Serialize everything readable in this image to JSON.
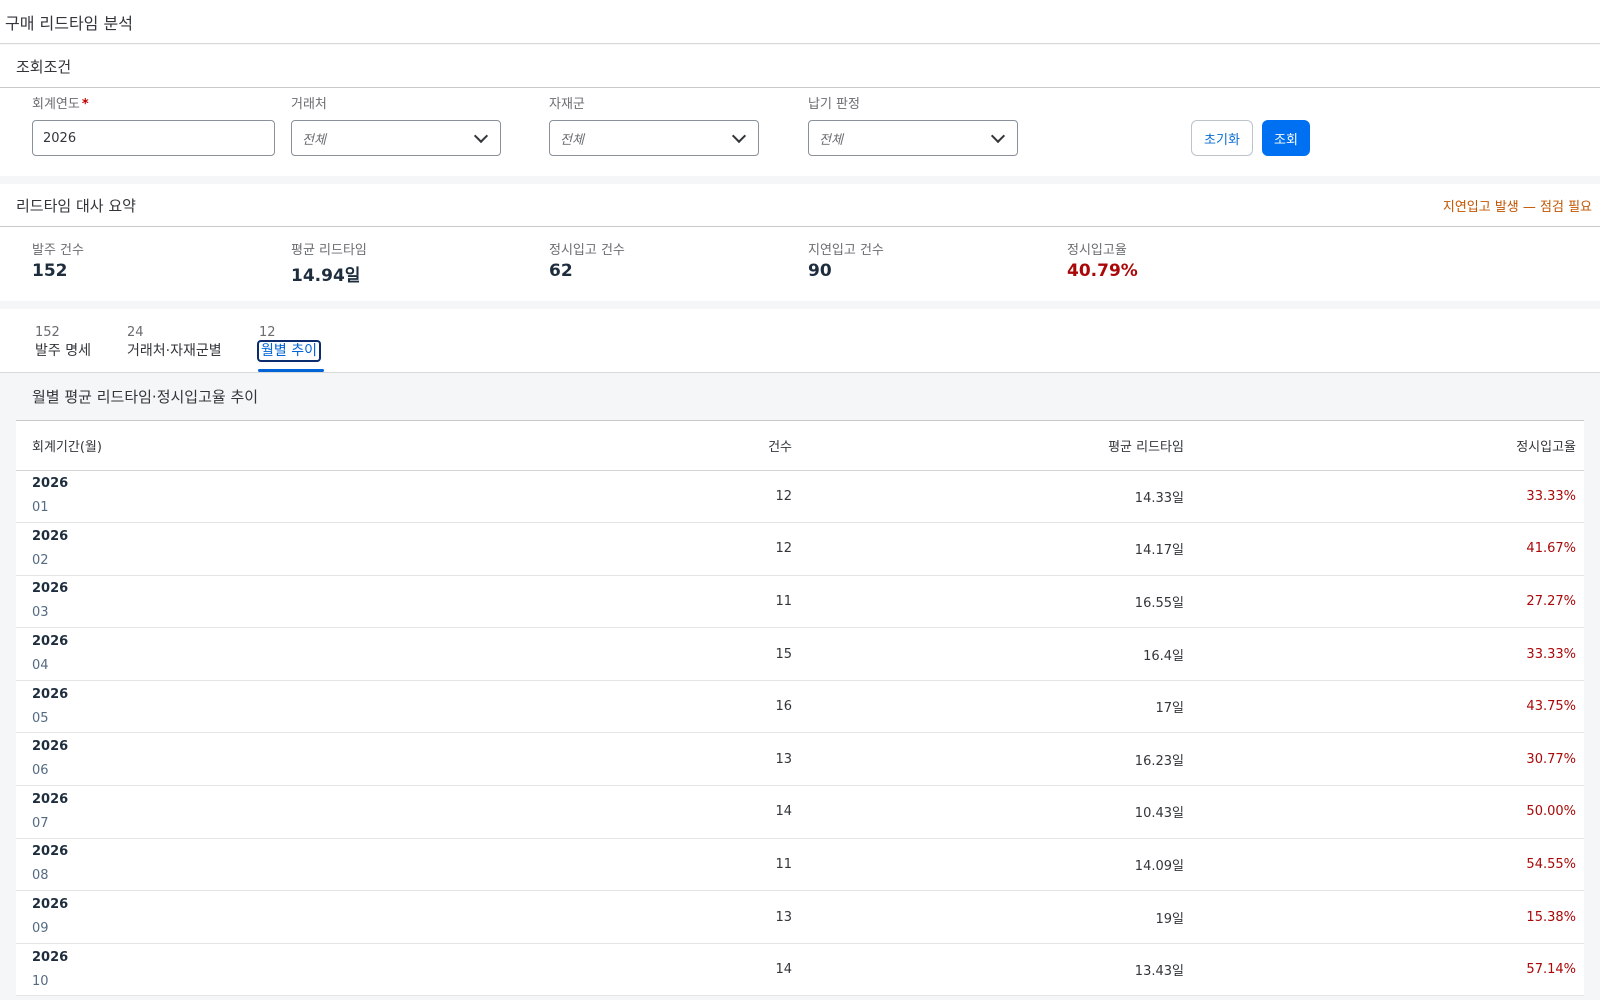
{
  "app": {
    "title": "구매 리드타임 분석"
  },
  "filter": {
    "header": "조회조건",
    "fiscal_year": {
      "label": "회계연도",
      "value": "2026"
    },
    "vendor": {
      "label": "거래처",
      "placeholder": "전체"
    },
    "material_group": {
      "label": "자재군",
      "placeholder": "전체"
    },
    "delivery_judgement": {
      "label": "납기 판정",
      "placeholder": "전체"
    },
    "reset_label": "초기화",
    "search_label": "조회"
  },
  "summary": {
    "title": "리드타임 대사 요약",
    "warning": "지연입고 발생 — 점검 필요",
    "kpis": [
      {
        "label": "발주 건수",
        "value": "152"
      },
      {
        "label": "평균 리드타임",
        "value": "14.94일"
      },
      {
        "label": "정시입고 건수",
        "value": "62"
      },
      {
        "label": "지연입고 건수",
        "value": "90"
      },
      {
        "label": "정시입고율",
        "value": "40.79%"
      }
    ]
  },
  "tabs": [
    {
      "count": "152",
      "label": "발주 명세"
    },
    {
      "count": "24",
      "label": "거래처·자재군별"
    },
    {
      "count": "12",
      "label": "월별 추이"
    }
  ],
  "table": {
    "title": "월별 평균 리드타임·정시입고율 추이",
    "columns": [
      "회계기간(월)",
      "건수",
      "평균 리드타임",
      "정시입고율"
    ],
    "rows": [
      {
        "year": "2026",
        "month": "01",
        "count": "12",
        "lead": "14.33일",
        "rate": "33.33%"
      },
      {
        "year": "2026",
        "month": "02",
        "count": "12",
        "lead": "14.17일",
        "rate": "41.67%"
      },
      {
        "year": "2026",
        "month": "03",
        "count": "11",
        "lead": "16.55일",
        "rate": "27.27%"
      },
      {
        "year": "2026",
        "month": "04",
        "count": "15",
        "lead": "16.4일",
        "rate": "33.33%"
      },
      {
        "year": "2026",
        "month": "05",
        "count": "16",
        "lead": "17일",
        "rate": "43.75%"
      },
      {
        "year": "2026",
        "month": "06",
        "count": "13",
        "lead": "16.23일",
        "rate": "30.77%"
      },
      {
        "year": "2026",
        "month": "07",
        "count": "14",
        "lead": "10.43일",
        "rate": "50.00%"
      },
      {
        "year": "2026",
        "month": "08",
        "count": "11",
        "lead": "14.09일",
        "rate": "54.55%"
      },
      {
        "year": "2026",
        "month": "09",
        "count": "13",
        "lead": "19일",
        "rate": "15.38%"
      },
      {
        "year": "2026",
        "month": "10",
        "count": "14",
        "lead": "13.43일",
        "rate": "57.14%"
      }
    ]
  },
  "colors": {
    "accent": "#0070f2",
    "negative": "#aa0808",
    "warning": "#c35500"
  }
}
